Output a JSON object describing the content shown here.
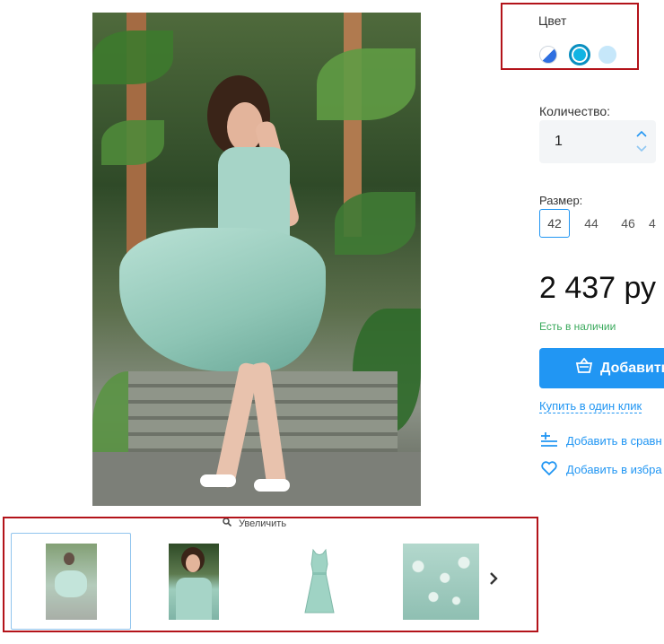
{
  "product": {
    "main_image_alt": "",
    "zoom_label": "Увеличить",
    "thumbnails": [
      {
        "icon": "thumb-photo-1"
      },
      {
        "icon": "thumb-photo-2"
      },
      {
        "icon": "thumb-photo-3"
      },
      {
        "icon": "thumb-photo-4"
      }
    ]
  },
  "color": {
    "label": "Цвет",
    "swatches": [
      {
        "color": "#2f6fe0",
        "selected": false
      },
      {
        "color": "#11b4e3",
        "selected": true
      },
      {
        "color": "#c6e7fa",
        "selected": false
      }
    ]
  },
  "quantity": {
    "label": "Количество:",
    "value": "1"
  },
  "size": {
    "label": "Размер:",
    "options": [
      "42",
      "44",
      "46",
      "4"
    ],
    "selected": "42"
  },
  "price": {
    "value": "2 437 ру"
  },
  "stock": {
    "text": "Есть в наличии"
  },
  "actions": {
    "add_to_cart": "Добавить",
    "buy_one_click": "Купить в один клик",
    "compare": "Добавить в сравн",
    "favorites": "Добавить в избра"
  },
  "colors": {
    "accent": "#2196f3",
    "highlight_border": "#b3131a",
    "stock_green": "#3aa95c"
  }
}
